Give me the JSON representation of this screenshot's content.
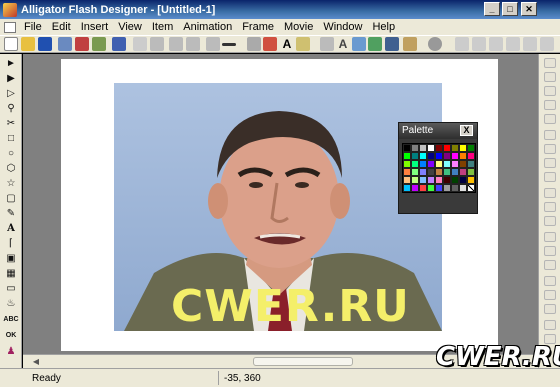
{
  "window": {
    "title": "Alligator Flash Designer - [Untitled-1]",
    "minimize": "_",
    "maximize": "□",
    "close": "✕"
  },
  "menubar": {
    "items": [
      "File",
      "Edit",
      "Insert",
      "View",
      "Item",
      "Animation",
      "Frame",
      "Movie",
      "Window",
      "Help"
    ]
  },
  "toolbar": {
    "buttons": [
      "new-icon",
      "open-icon",
      "save-icon",
      "print-icon",
      "copy-icon",
      "paste-icon",
      "cut-icon",
      "line-width-icon",
      "text-icon",
      "hand-icon",
      "zoom-icon"
    ]
  },
  "tools": {
    "labels": [
      "A",
      "ABC",
      "OK"
    ]
  },
  "palette": {
    "title": "Palette",
    "close": "X",
    "colors": [
      "#000000",
      "#808080",
      "#c0c0c0",
      "#ffffff",
      "#800000",
      "#ff0000",
      "#808000",
      "#ffff00",
      "#008000",
      "#00ff00",
      "#008080",
      "#00ffff",
      "#000080",
      "#0000ff",
      "#800080",
      "#ff00ff",
      "#ff8000",
      "#ff0080",
      "#80ff00",
      "#00ff80",
      "#0080ff",
      "#8000ff",
      "#ffff80",
      "#80ffff",
      "#ff80ff",
      "#804000",
      "#408080",
      "#ff8040",
      "#80ff80",
      "#8080ff",
      "#404040",
      "#c08040",
      "#40c080",
      "#4080c0",
      "#c04080",
      "#80c040",
      "#ffc080",
      "#c0ff80",
      "#80c0ff",
      "#c080ff",
      "#ff80c0",
      "#400000",
      "#004000",
      "#000040",
      "#ffc000",
      "#00c0ff",
      "#c000ff",
      "#ff4040",
      "#40ff40",
      "#4040ff",
      "#a0a0a0",
      "#606060",
      "#e0e0e0",
      "none"
    ]
  },
  "stage": {
    "watermark_text": "CWER.RU"
  },
  "status": {
    "left": "Ready",
    "coords": "-35, 360"
  },
  "branding": {
    "logo_text": "CWER.RU"
  }
}
